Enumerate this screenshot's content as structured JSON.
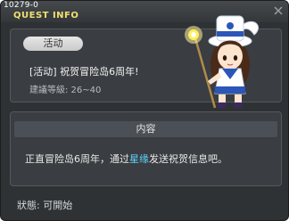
{
  "window": {
    "quest_id": "10279-0",
    "title": "QUEST INFO",
    "close_icon": "close-icon"
  },
  "quest": {
    "badge": "活动",
    "title": "[活动]  祝贺冒险岛6周年!",
    "level_text": "建議等級: 26~40",
    "npc_icon": "npc-girl-sailor-icon"
  },
  "content": {
    "header": "内容",
    "text_before": "正直冒险岛6周年，通过",
    "text_highlight": "星缘",
    "text_after": "发送祝贺信息吧。"
  },
  "status": {
    "text": "狀態:  可開始"
  },
  "colors": {
    "title": "#f0e070",
    "highlight": "#5fd4ff",
    "background": "#2f3235"
  }
}
